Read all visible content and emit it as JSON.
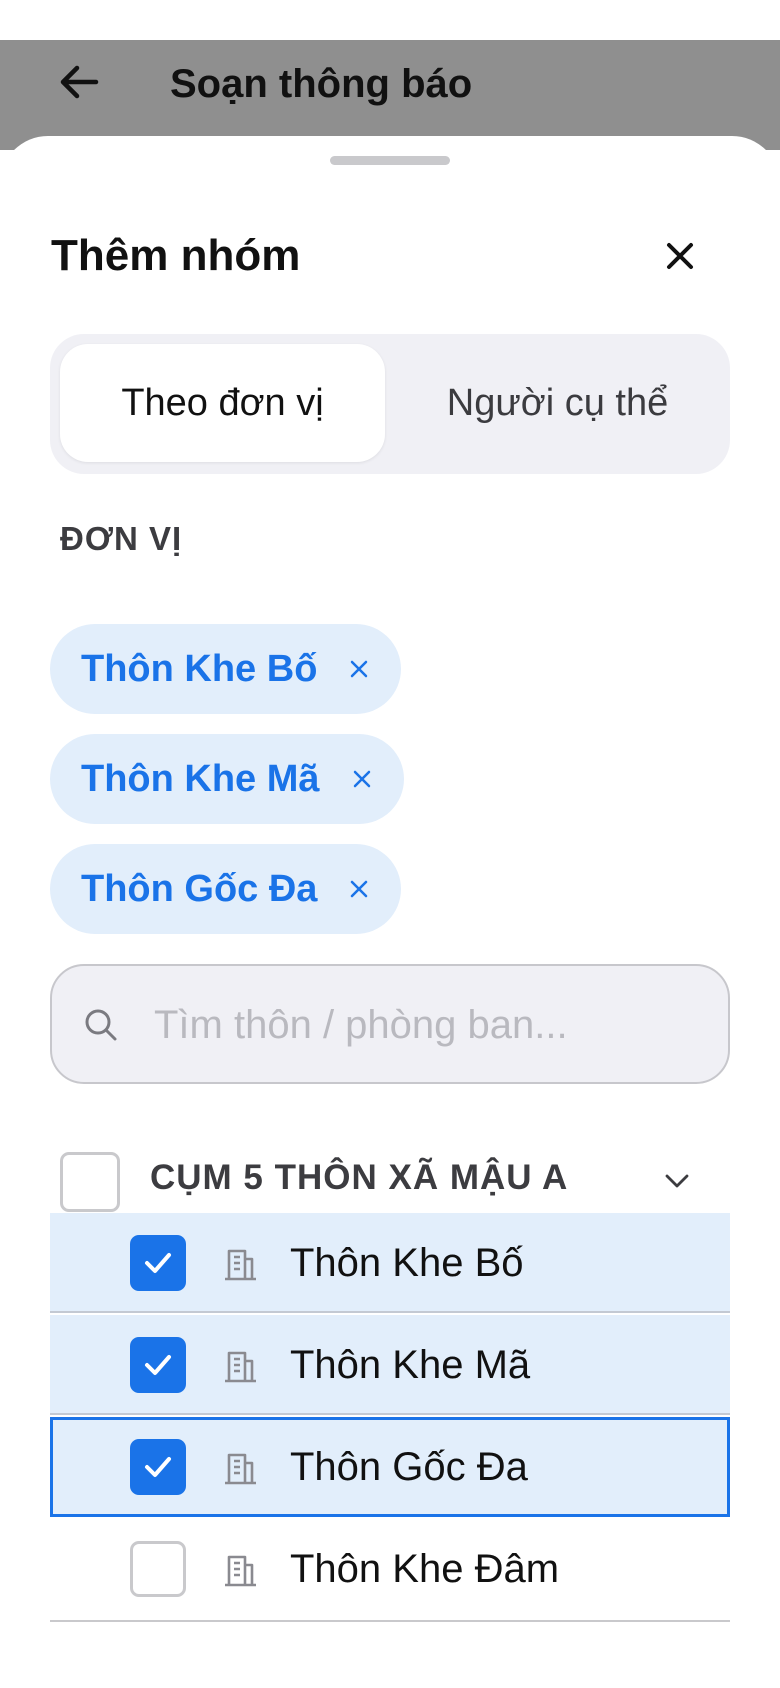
{
  "appbar": {
    "title": "Soạn thông báo",
    "back_icon": "arrow-left-icon"
  },
  "sheet": {
    "title": "Thêm nhóm",
    "close_icon": "close-icon",
    "tabs": [
      {
        "label": "Theo đơn vị",
        "active": true
      },
      {
        "label": "Người cụ thể",
        "active": false
      }
    ],
    "section_label": "ĐƠN VỊ",
    "chips": [
      {
        "label": "Thôn Khe Bố"
      },
      {
        "label": "Thôn Khe Mã"
      },
      {
        "label": "Thôn Gốc Đa"
      }
    ],
    "search": {
      "placeholder": "Tìm thôn / phòng ban...",
      "value": ""
    },
    "group": {
      "title": "CỤM 5 THÔN XÃ MẬU A",
      "checked": false,
      "expanded": true
    },
    "items": [
      {
        "label": "Thôn Khe Bố",
        "checked": true
      },
      {
        "label": "Thôn Khe Mã",
        "checked": true
      },
      {
        "label": "Thôn Gốc Đa",
        "checked": true
      },
      {
        "label": "Thôn Khe Đâm",
        "checked": false
      }
    ]
  },
  "colors": {
    "accent": "#1a73e8",
    "chip_bg": "#e2eefb",
    "scrim": "#8f8f8f"
  }
}
